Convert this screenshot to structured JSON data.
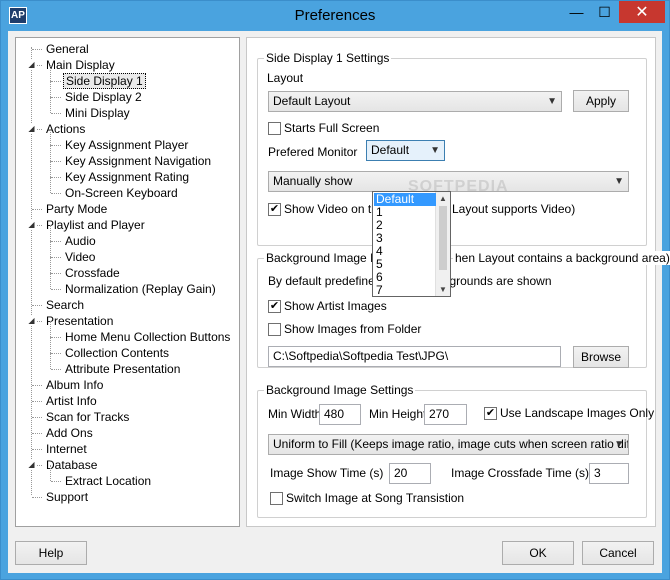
{
  "window": {
    "title": "Preferences",
    "app_icon_text": "AP",
    "minimize_glyph": "—",
    "maximize_glyph": "☐",
    "close_glyph": "✕"
  },
  "tree": {
    "items": [
      {
        "label": "General",
        "level": 0,
        "expander": ""
      },
      {
        "label": "Main Display",
        "level": 0,
        "expander": "◢"
      },
      {
        "label": "Side Display 1",
        "level": 1,
        "expander": "",
        "selected": true
      },
      {
        "label": "Side Display 2",
        "level": 1,
        "expander": ""
      },
      {
        "label": "Mini Display",
        "level": 1,
        "expander": ""
      },
      {
        "label": "Actions",
        "level": 0,
        "expander": "◢"
      },
      {
        "label": "Key Assignment Player",
        "level": 1,
        "expander": ""
      },
      {
        "label": "Key Assignment Navigation",
        "level": 1,
        "expander": ""
      },
      {
        "label": "Key Assignment Rating",
        "level": 1,
        "expander": ""
      },
      {
        "label": "On-Screen Keyboard",
        "level": 1,
        "expander": ""
      },
      {
        "label": "Party Mode",
        "level": 0,
        "expander": ""
      },
      {
        "label": "Playlist and Player",
        "level": 0,
        "expander": "◢"
      },
      {
        "label": "Audio",
        "level": 1,
        "expander": ""
      },
      {
        "label": "Video",
        "level": 1,
        "expander": ""
      },
      {
        "label": "Crossfade",
        "level": 1,
        "expander": ""
      },
      {
        "label": "Normalization (Replay Gain)",
        "level": 1,
        "expander": ""
      },
      {
        "label": "Search",
        "level": 0,
        "expander": ""
      },
      {
        "label": "Presentation",
        "level": 0,
        "expander": "◢"
      },
      {
        "label": "Home Menu Collection Buttons",
        "level": 1,
        "expander": ""
      },
      {
        "label": "Collection Contents",
        "level": 1,
        "expander": ""
      },
      {
        "label": "Attribute Presentation",
        "level": 1,
        "expander": ""
      },
      {
        "label": "Album Info",
        "level": 0,
        "expander": ""
      },
      {
        "label": "Artist Info",
        "level": 0,
        "expander": ""
      },
      {
        "label": "Scan for Tracks",
        "level": 0,
        "expander": ""
      },
      {
        "label": "Add Ons",
        "level": 0,
        "expander": ""
      },
      {
        "label": "Internet",
        "level": 0,
        "expander": ""
      },
      {
        "label": "Database",
        "level": 0,
        "expander": "◢"
      },
      {
        "label": "Extract Location",
        "level": 1,
        "expander": ""
      },
      {
        "label": "Support",
        "level": 0,
        "expander": ""
      }
    ]
  },
  "side_display": {
    "group_title": "Side Display 1 Settings",
    "layout_label": "Layout",
    "layout_value": "Default Layout",
    "apply_label": "Apply",
    "starts_full_screen_label": "Starts Full Screen",
    "starts_full_screen_checked": false,
    "prefered_monitor_label": "Prefered Monitor",
    "prefered_monitor_value": "Default",
    "mode_value": "Manually show",
    "show_video_label_left": "Show Video on th",
    "show_video_label_right": "Layout supports Video)",
    "show_video_checked": true
  },
  "monitor_dropdown": {
    "options": [
      "Default",
      "1",
      "2",
      "3",
      "4",
      "5",
      "6",
      "7"
    ],
    "highlighted_index": 0
  },
  "background_rep": {
    "group_title_left": "Background Image Re",
    "group_title_right": "hen Layout contains a background area)",
    "info_text": "By default predefined Layout backgrounds are shown",
    "show_artist_images_label": "Show Artist Images",
    "show_artist_images_checked": true,
    "show_images_from_folder_label": "Show Images from Folder",
    "show_images_from_folder_checked": false,
    "folder_path": "C:\\Softpedia\\Softpedia Test\\JPG\\",
    "browse_label": "Browse"
  },
  "background_settings": {
    "group_title": "Background Image Settings",
    "min_width_label": "Min Width",
    "min_width_value": "480",
    "min_height_label": "Min Height",
    "min_height_value": "270",
    "landscape_label": "Use Landscape Images Only",
    "landscape_checked": true,
    "fill_mode_value": "Uniform to Fill (Keeps image ratio, image cuts when screen ratio differs",
    "show_time_label": "Image Show Time (s)",
    "show_time_value": "20",
    "crossfade_time_label": "Image Crossfade Time (s)",
    "crossfade_time_value": "3",
    "switch_image_label": "Switch Image at Song Transistion",
    "switch_image_checked": false
  },
  "footer": {
    "help_label": "Help",
    "ok_label": "OK",
    "cancel_label": "Cancel"
  },
  "watermark": "SOFTPEDIA",
  "colors": {
    "titlebar": "#4aa3df",
    "close_button": "#c7372f",
    "selection_highlight": "#3399ff"
  }
}
